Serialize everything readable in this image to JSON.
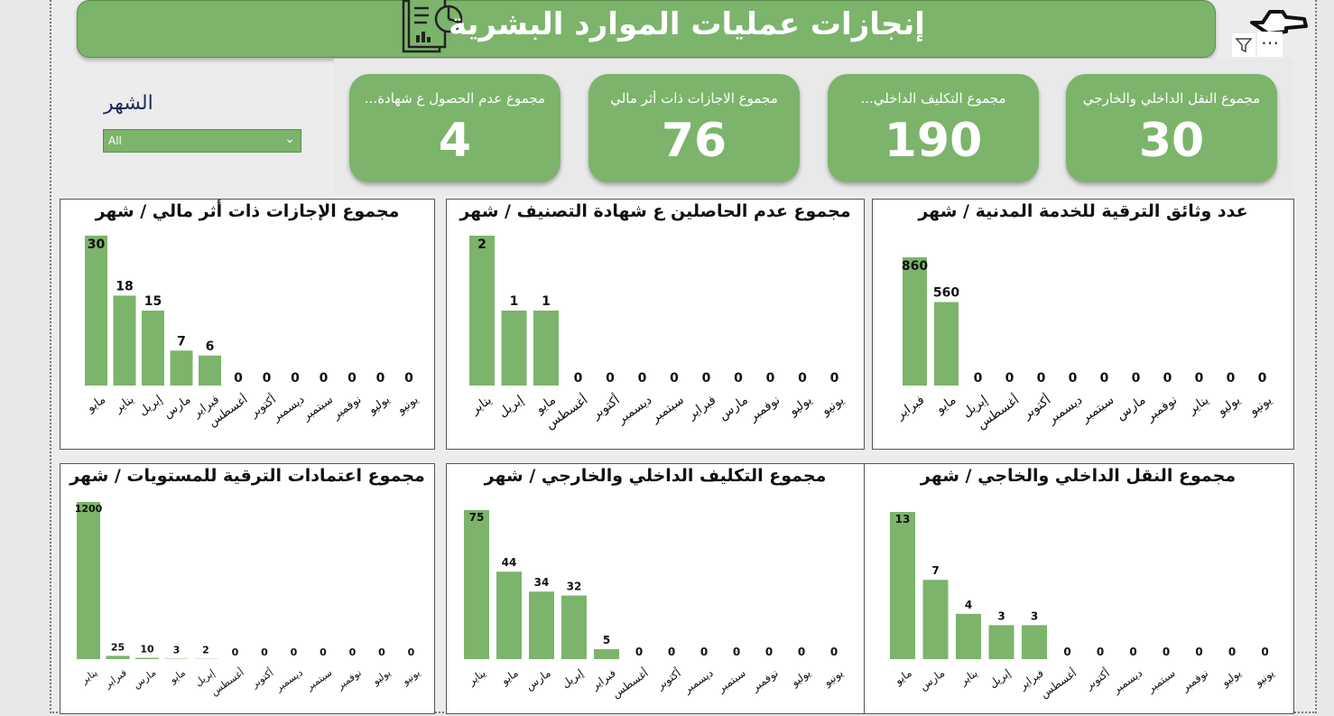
{
  "header": {
    "title": "إنجازات عمليات الموارد البشرية"
  },
  "slicer": {
    "title": "الشهر",
    "value": "All",
    "chevron_icon": "chevron-down-icon"
  },
  "toolbar": {
    "filter_icon": "filter-icon",
    "more_icon": "more-options-icon",
    "more_label": "⋯"
  },
  "kpis": [
    {
      "label": "مجموع النقل الداخلي والخارجي",
      "value": "30"
    },
    {
      "label": "مجموع التكليف الداخلي...",
      "value": "190"
    },
    {
      "label": "مجموع الاجازات ذات أثر مالي",
      "value": "76"
    },
    {
      "label": "مجموع عدم الحصول ع شهادة...",
      "value": "4"
    }
  ],
  "colors": {
    "bar": "#7cb46b",
    "header": "#7cb46b",
    "text": "#111111"
  },
  "chart_data": [
    {
      "type": "bar",
      "title": "عدد وثائق الترقية للخدمة المدنية / شهر",
      "categories": [
        "فبراير",
        "مايو",
        "إبريل",
        "أغسطس",
        "أكتوبر",
        "ديسمبر",
        "سبتمبر",
        "مارس",
        "نوفمبر",
        "يناير",
        "يوليو",
        "يونيو"
      ],
      "values": [
        860,
        560,
        0,
        0,
        0,
        0,
        0,
        0,
        0,
        0,
        0,
        0
      ]
    },
    {
      "type": "bar",
      "title": "مجموع عدم الحاصلين ع شهادة التصنيف / شهر",
      "categories": [
        "يناير",
        "إبريل",
        "مايو",
        "أغسطس",
        "أكتوبر",
        "ديسمبر",
        "سبتمبر",
        "فبراير",
        "مارس",
        "نوفمبر",
        "يوليو",
        "يونيو"
      ],
      "values": [
        2,
        1,
        1,
        0,
        0,
        0,
        0,
        0,
        0,
        0,
        0,
        0
      ]
    },
    {
      "type": "bar",
      "title": "مجموع الإجازات ذات أثر مالي / شهر",
      "categories": [
        "مايو",
        "يناير",
        "إبريل",
        "مارس",
        "فبراير",
        "أغسطس",
        "أكتوبر",
        "ديسمبر",
        "سبتمبر",
        "نوفمبر",
        "يوليو",
        "يونيو"
      ],
      "values": [
        30,
        18,
        15,
        7,
        6,
        0,
        0,
        0,
        0,
        0,
        0,
        0
      ]
    },
    {
      "type": "bar",
      "title": "مجموع النقل الداخلي والخاجي / شهر",
      "categories": [
        "مايو",
        "مارس",
        "يناير",
        "إبريل",
        "فبراير",
        "أغسطس",
        "أكتوبر",
        "ديسمبر",
        "سبتمبر",
        "نوفمبر",
        "يوليو",
        "يونيو"
      ],
      "values": [
        13,
        7,
        4,
        3,
        3,
        0,
        0,
        0,
        0,
        0,
        0,
        0
      ]
    },
    {
      "type": "bar",
      "title": "مجموع التكليف الداخلي والخارجي / شهر",
      "categories": [
        "يناير",
        "مايو",
        "مارس",
        "إبريل",
        "فبراير",
        "أغسطس",
        "أكتوبر",
        "ديسمبر",
        "سبتمبر",
        "نوفمبر",
        "يوليو",
        "يونيو"
      ],
      "values": [
        75,
        44,
        34,
        32,
        5,
        0,
        0,
        0,
        0,
        0,
        0,
        0
      ]
    },
    {
      "type": "bar",
      "title": "مجموع اعتمادات الترقية للمستويات / شهر",
      "categories": [
        "يناير",
        "فبراير",
        "مارس",
        "مايو",
        "إبريل",
        "أغسطس",
        "أكتوبر",
        "ديسمبر",
        "سبتمبر",
        "نوفمبر",
        "يوليو",
        "يونيو"
      ],
      "values": [
        1200,
        25,
        10,
        3,
        2,
        0,
        0,
        0,
        0,
        0,
        0,
        0
      ]
    }
  ]
}
